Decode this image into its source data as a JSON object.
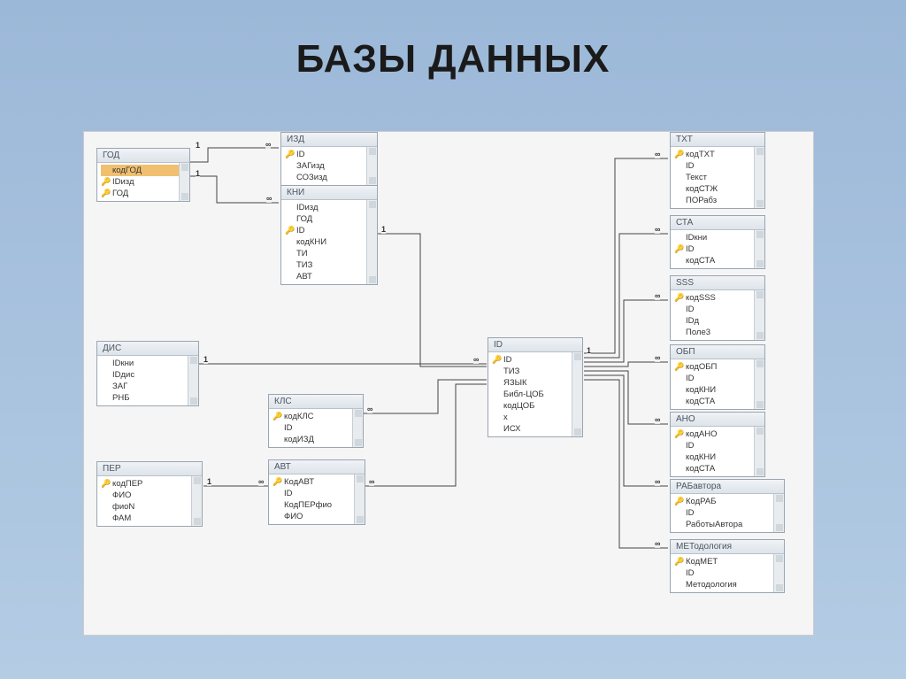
{
  "title": "БАЗЫ ДАННЫХ",
  "tables": {
    "god": {
      "name": "ГОД",
      "fields": [
        {
          "key": false,
          "name": "кодГОД",
          "selected": true
        },
        {
          "key": true,
          "name": "IDизд"
        },
        {
          "key": true,
          "name": "ГОД"
        }
      ]
    },
    "izd": {
      "name": "ИЗД",
      "fields": [
        {
          "key": true,
          "name": "ID"
        },
        {
          "key": false,
          "name": "ЗАГизд"
        },
        {
          "key": false,
          "name": "СОЗизд"
        }
      ]
    },
    "kni": {
      "name": "КНИ",
      "fields": [
        {
          "key": false,
          "name": "IDизд"
        },
        {
          "key": false,
          "name": "ГОД"
        },
        {
          "key": true,
          "name": "ID"
        },
        {
          "key": false,
          "name": "кодКНИ"
        },
        {
          "key": false,
          "name": "ТИ"
        },
        {
          "key": false,
          "name": "ТИЗ"
        },
        {
          "key": false,
          "name": "АВТ"
        }
      ]
    },
    "dis": {
      "name": "ДИС",
      "fields": [
        {
          "key": false,
          "name": "IDкни"
        },
        {
          "key": false,
          "name": "IDдис"
        },
        {
          "key": false,
          "name": "ЗАГ"
        },
        {
          "key": false,
          "name": "РНБ"
        }
      ]
    },
    "kls": {
      "name": "КЛС",
      "fields": [
        {
          "key": true,
          "name": "кодКЛС"
        },
        {
          "key": false,
          "name": "ID"
        },
        {
          "key": false,
          "name": "кодИЗД"
        }
      ]
    },
    "per": {
      "name": "ПЕР",
      "fields": [
        {
          "key": true,
          "name": "кодПЕР"
        },
        {
          "key": false,
          "name": "ФИО"
        },
        {
          "key": false,
          "name": "фиоN"
        },
        {
          "key": false,
          "name": "ФАМ"
        }
      ]
    },
    "avt": {
      "name": "АВТ",
      "fields": [
        {
          "key": true,
          "name": "КодАВТ"
        },
        {
          "key": false,
          "name": "ID"
        },
        {
          "key": false,
          "name": "КодПЕРфио"
        },
        {
          "key": false,
          "name": "ФИО"
        }
      ]
    },
    "id": {
      "name": "ID",
      "fields": [
        {
          "key": true,
          "name": "ID"
        },
        {
          "key": false,
          "name": "ТИЗ"
        },
        {
          "key": false,
          "name": "ЯЗЫК"
        },
        {
          "key": false,
          "name": "Библ-ЦОБ"
        },
        {
          "key": false,
          "name": "кодЦОБ"
        },
        {
          "key": false,
          "name": "x"
        },
        {
          "key": false,
          "name": "ИСХ"
        }
      ]
    },
    "txt": {
      "name": "ТХТ",
      "fields": [
        {
          "key": true,
          "name": "кодТХТ"
        },
        {
          "key": false,
          "name": "ID"
        },
        {
          "key": false,
          "name": "Текст"
        },
        {
          "key": false,
          "name": "кодСТЖ"
        },
        {
          "key": false,
          "name": "ПОРабз"
        }
      ]
    },
    "cta": {
      "name": "СТА",
      "fields": [
        {
          "key": false,
          "name": "IDкни"
        },
        {
          "key": true,
          "name": "ID"
        },
        {
          "key": false,
          "name": "кодСТА"
        }
      ]
    },
    "sss": {
      "name": "SSS",
      "fields": [
        {
          "key": true,
          "name": "кодSSS"
        },
        {
          "key": false,
          "name": "ID"
        },
        {
          "key": false,
          "name": "IDд"
        },
        {
          "key": false,
          "name": "Поле3"
        }
      ]
    },
    "obp": {
      "name": "ОБП",
      "fields": [
        {
          "key": true,
          "name": "кодОБП"
        },
        {
          "key": false,
          "name": "ID"
        },
        {
          "key": false,
          "name": "кодКНИ"
        },
        {
          "key": false,
          "name": "кодСТА"
        }
      ]
    },
    "ano": {
      "name": "АНО",
      "fields": [
        {
          "key": true,
          "name": "кодАНО"
        },
        {
          "key": false,
          "name": "ID"
        },
        {
          "key": false,
          "name": "кодКНИ"
        },
        {
          "key": false,
          "name": "кодСТА"
        }
      ]
    },
    "rab": {
      "name": "РАБавтора",
      "fields": [
        {
          "key": true,
          "name": "КодРАБ"
        },
        {
          "key": false,
          "name": "ID"
        },
        {
          "key": false,
          "name": "РаботыАвтора"
        }
      ]
    },
    "met": {
      "name": "МЕТодология",
      "fields": [
        {
          "key": true,
          "name": "КодМЕТ"
        },
        {
          "key": false,
          "name": "ID"
        },
        {
          "key": false,
          "name": "Методология"
        }
      ]
    }
  },
  "cardinality": {
    "one": "1",
    "many": "∞"
  }
}
